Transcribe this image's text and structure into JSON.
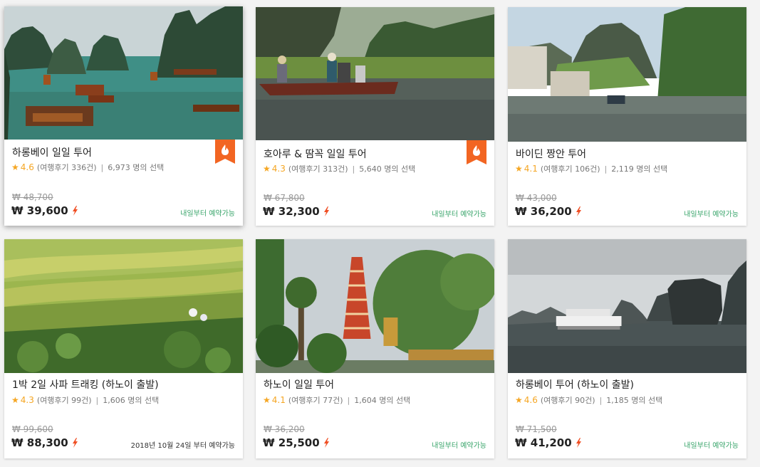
{
  "currency": "₩",
  "colors": {
    "accent": "#f5a623",
    "badge": "#f26522",
    "available": "#3aa56b",
    "bolt": "#f04e23"
  },
  "tours": [
    {
      "title": "하롱베이 일일 투어",
      "rating": "4.6",
      "reviews": "(여행후기 336건)",
      "chosen": "6,973 명의 선택",
      "old_price": "₩ 48,700",
      "price": "₩ 39,600",
      "availability": "내일부터 예약가능",
      "badge": "fire-badge-icon",
      "image": "halong-bay-boats"
    },
    {
      "title": "호아루 & 땀꼭 일일 투어",
      "rating": "4.3",
      "reviews": "(여행후기 313건)",
      "chosen": "5,640 명의 선택",
      "old_price": "₩ 67,800",
      "price": "₩ 32,300",
      "availability": "내일부터 예약가능",
      "badge": "fire-badge-icon",
      "image": "tam-coc-rowing-boat"
    },
    {
      "title": "바이딘 짱안 투어",
      "rating": "4.1",
      "reviews": "(여행후기 106건)",
      "chosen": "2,119 명의 선택",
      "old_price": "₩ 43,000",
      "price": "₩ 36,200",
      "availability": "내일부터 예약가능",
      "image": "trang-an-river"
    },
    {
      "title": "1박 2일 사파 트래킹 (하노이 출발)",
      "rating": "4.3",
      "reviews": "(여행후기 99건)",
      "chosen": "1,606 명의 선택",
      "old_price": "₩ 99,600",
      "price": "₩ 88,300",
      "availability": "2018년 10월 24일 부터 예약가능",
      "image": "sapa-rice-terraces"
    },
    {
      "title": "하노이 일일 투어",
      "rating": "4.1",
      "reviews": "(여행후기 77건)",
      "chosen": "1,604 명의 선택",
      "old_price": "₩ 36,200",
      "price": "₩ 25,500",
      "availability": "내일부터 예약가능",
      "image": "tran-quoc-pagoda"
    },
    {
      "title": "하롱베이 투어 (하노이 출발)",
      "rating": "4.6",
      "reviews": "(여행후기 90건)",
      "chosen": "1,185 명의 선택",
      "old_price": "₩ 71,500",
      "price": "₩ 41,200",
      "availability": "내일부터 예약가능",
      "image": "halong-bay-cruise"
    }
  ]
}
